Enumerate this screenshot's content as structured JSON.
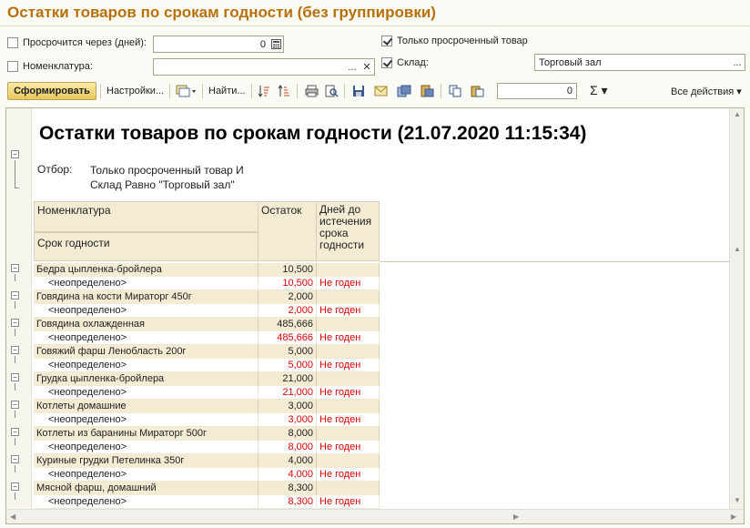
{
  "window": {
    "title": "Остатки товаров по срокам годности (без группировки)"
  },
  "filters": {
    "expires_label": "Просрочится через (дней):",
    "expires_value": "0",
    "nomenclature_label": "Номенклатура:",
    "nomenclature_value": "",
    "only_expired_label": "Только просроченный товар",
    "warehouse_label": "Склад:",
    "warehouse_value": "Торговый зал",
    "ellipsis": "...",
    "clear": "✕"
  },
  "toolbar": {
    "generate_label": "Сформировать",
    "settings_label": "Настройки...",
    "find_label": "Найти...",
    "number_value": "0",
    "sum_label": "Σ ▾",
    "all_actions_label": "Все действия ▾"
  },
  "report": {
    "title": "Остатки товаров по срокам годности (21.07.2020 11:15:34)",
    "filter_label": "Отбор:",
    "filter_line1": "Только просроченный товар И",
    "filter_line2": "Склад Равно \"Торговый зал\"",
    "columns": {
      "nomenclature": "Номенклатура",
      "shelf_life": "Срок годности",
      "balance": "Остаток",
      "days_left_1": "Дней до",
      "days_left_2": "истечения",
      "days_left_3": "срока",
      "days_left_4": "годности"
    },
    "rows": [
      {
        "name": "Бедра цыпленка-бройлера",
        "qty": "10,500",
        "sub": "<неопределено>",
        "sub_qty": "10,500",
        "status": "Не годен"
      },
      {
        "name": "Говядина на кости Мираторг 450г",
        "qty": "2,000",
        "sub": "<неопределено>",
        "sub_qty": "2,000",
        "status": "Не годен"
      },
      {
        "name": "Говядина охлажденная",
        "qty": "485,666",
        "sub": "<неопределено>",
        "sub_qty": "485,666",
        "status": "Не годен"
      },
      {
        "name": "Говяжий фарш Ленобласть 200г",
        "qty": "5,000",
        "sub": "<неопределено>",
        "sub_qty": "5,000",
        "status": "Не годен"
      },
      {
        "name": "Грудка цыпленка-бройлера",
        "qty": "21,000",
        "sub": "<неопределено>",
        "sub_qty": "21,000",
        "status": "Не годен"
      },
      {
        "name": "Котлеты домашние",
        "qty": "3,000",
        "sub": "<неопределено>",
        "sub_qty": "3,000",
        "status": "Не годен"
      },
      {
        "name": "Котлеты из баранины Мираторг 500г",
        "qty": "8,000",
        "sub": "<неопределено>",
        "sub_qty": "8,000",
        "status": "Не годен"
      },
      {
        "name": "Куриные грудки Петелинка 350г",
        "qty": "4,000",
        "sub": "<неопределено>",
        "sub_qty": "4,000",
        "status": "Не годен"
      },
      {
        "name": "Мясной фарш, домашний",
        "qty": "8,300",
        "sub": "<неопределено>",
        "sub_qty": "8,300",
        "status": "Не годен"
      }
    ]
  }
}
